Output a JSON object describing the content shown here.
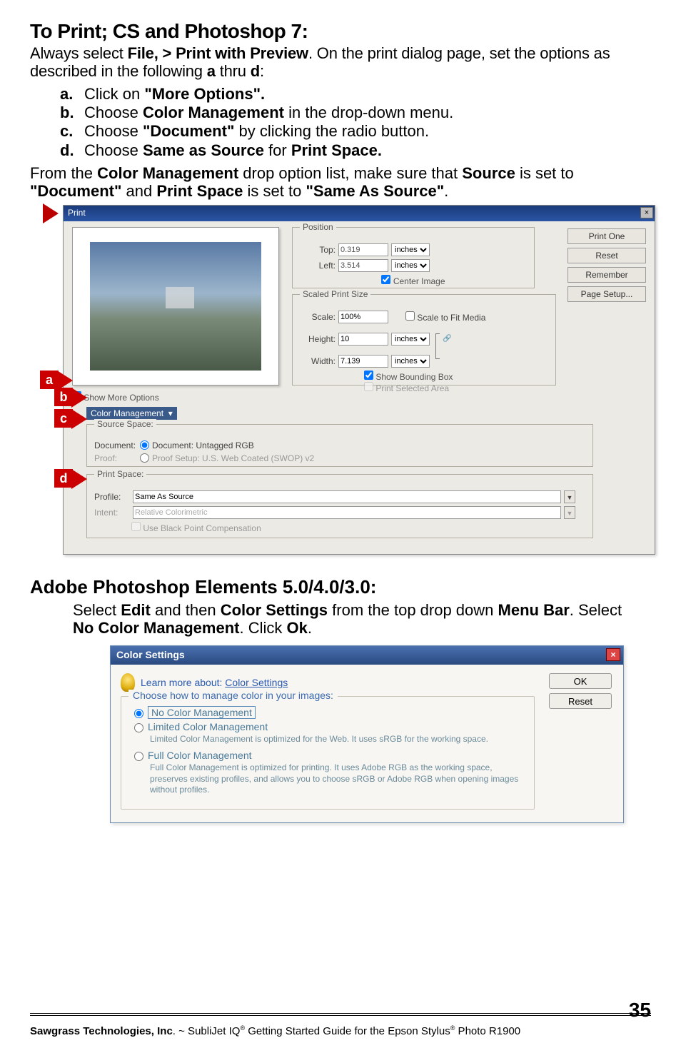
{
  "heading1": "To Print; CS and Photoshop 7:",
  "intro_parts": {
    "pre": "Always select ",
    "b1": "File, > Print with Preview",
    "mid": ".   On the print dialog page, set the options as described in the following ",
    "b2": "a",
    "mid2": " thru ",
    "b3": "d",
    "end": ":"
  },
  "steps": [
    {
      "lett": "a.",
      "pre": "Click on ",
      "b1": "\"More Options\"."
    },
    {
      "lett": "b.",
      "pre": "Choose ",
      "b1": "Color Management",
      "post": " in the drop-down menu."
    },
    {
      "lett": "c.",
      "pre": "Choose ",
      "b1": "\"Document\"",
      "post": " by clicking the radio button."
    },
    {
      "lett": "d.",
      "pre": "Choose ",
      "b1": "Same as Source",
      "mid": " for ",
      "b2": "Print Space."
    }
  ],
  "para2": {
    "pre": "From the ",
    "b1": "Color Management",
    "mid1": " drop option list, make sure that ",
    "b2": "Source",
    "mid2": " is set to ",
    "b3": "\"Document\"",
    "mid3": " and ",
    "b4": "Print Space",
    "mid4": " is set to ",
    "b5": "\"Same As Source\"",
    "end": "."
  },
  "dialog": {
    "title": "Print",
    "position": {
      "legend": "Position",
      "top_lbl": "Top:",
      "top_val": "0.319",
      "top_unit": "inches",
      "left_lbl": "Left:",
      "left_val": "3.514",
      "left_unit": "inches",
      "center": "Center Image"
    },
    "scaled": {
      "legend": "Scaled Print Size",
      "scale_lbl": "Scale:",
      "scale_val": "100%",
      "scale_fit": "Scale to Fit Media",
      "height_lbl": "Height:",
      "height_val": "10",
      "height_unit": "inches",
      "width_lbl": "Width:",
      "width_val": "7.139",
      "width_unit": "inches",
      "show_bb": "Show Bounding Box",
      "print_sel": "Print Selected Area"
    },
    "buttons": {
      "print": "Print One",
      "reset": "Reset",
      "remember": "Remember",
      "pagesetup": "Page Setup..."
    },
    "showmore": "Show More Options",
    "color_mgmt": "Color Management",
    "source": {
      "legend": "Source Space:",
      "doc_lbl": "Document:",
      "doc_val": "Document: Untagged RGB",
      "proof_lbl": "Proof:",
      "proof_val": "Proof Setup: U.S. Web Coated (SWOP) v2"
    },
    "print_space": {
      "legend": "Print Space:",
      "profile_lbl": "Profile:",
      "profile_val": "Same As Source",
      "intent_lbl": "Intent:",
      "intent_val": "Relative Colorimetric",
      "blackpoint": "Use Black Point Compensation"
    }
  },
  "elements_heading": "Adobe Photoshop Elements 5.0/4.0/3.0:",
  "elements_para": {
    "pre": "Select ",
    "b1": "Edit",
    "mid1": " and then ",
    "b2": "Color Settings",
    "mid2": " from the top drop down ",
    "b3": "Menu Bar",
    "mid3": ".  Select ",
    "b4": "No Color Management",
    "mid4": ". Click ",
    "b5": "Ok",
    "end": "."
  },
  "cs": {
    "title": "Color Settings",
    "learn_pre": "Learn more about: ",
    "learn_link": "Color Settings",
    "ok": "OK",
    "reset": "Reset",
    "choose_legend": "Choose how to manage color in your images:",
    "opt1": "No Color Management",
    "opt2": "Limited Color Management",
    "opt2_desc": "Limited Color Management is optimized for the Web. It uses sRGB for the working space.",
    "opt3": "Full Color Management",
    "opt3_desc": "Full Color Management is optimized for printing. It uses Adobe RGB as the working space, preserves existing profiles, and allows you to choose sRGB or Adobe RGB when opening images without profiles."
  },
  "footer": {
    "company": "Sawgrass Technologies, Inc",
    "rest": ". ~ SubliJet IQ",
    "mid": " Getting Started Guide for the Epson Stylus",
    "end": " Photo R1900",
    "pagenum": "35",
    "reg": "®"
  }
}
